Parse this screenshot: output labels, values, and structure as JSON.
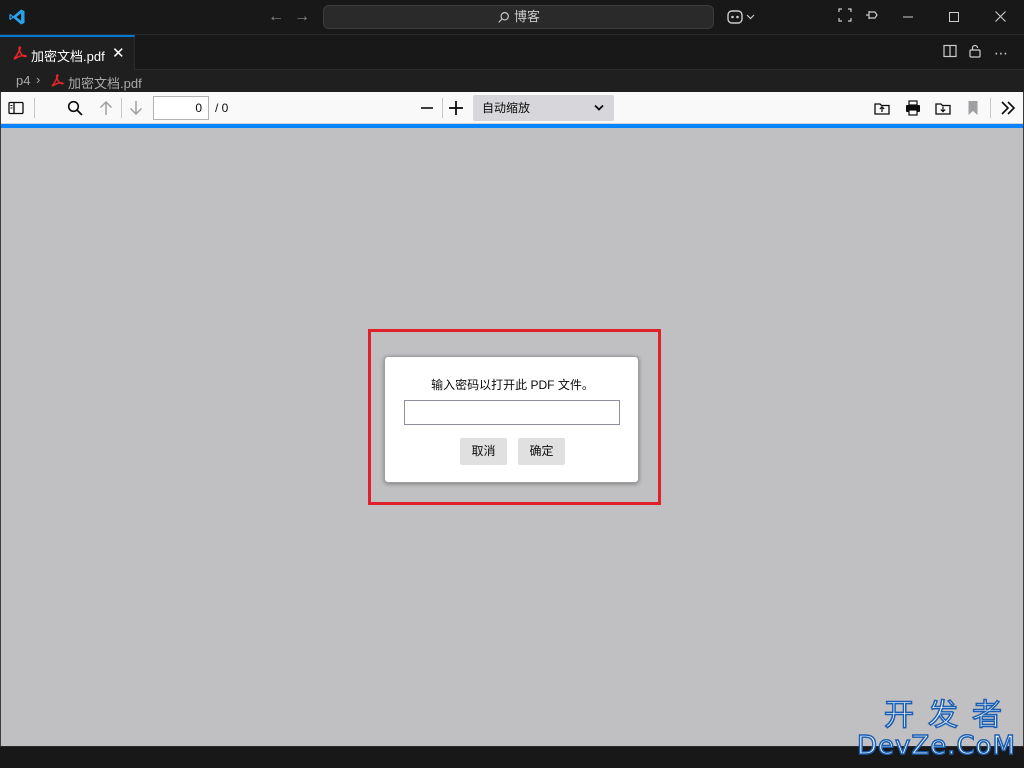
{
  "titlebar": {
    "search_text": "博客",
    "icons": {
      "logo": "vscode-logo-icon",
      "back": "arrow-left-icon",
      "forward": "arrow-right-icon",
      "search": "search-icon",
      "copilot": "copilot-icon",
      "layout": "customize-layout-icon",
      "pin": "pin-icon",
      "minimize": "minimize-icon",
      "maximize": "maximize-icon",
      "close": "close-icon"
    }
  },
  "tabs": [
    {
      "label": "加密文档.pdf",
      "icon": "pdf-icon",
      "active": true
    }
  ],
  "tab_actions": [
    "split-editor-icon",
    "lock-icon",
    "more-icon"
  ],
  "breadcrumb": {
    "folder": "p4",
    "file": "加密文档.pdf"
  },
  "pdf_toolbar": {
    "page_value": "0",
    "page_count": "/ 0",
    "zoom_label": "自动缩放"
  },
  "dialog": {
    "message": "输入密码以打开此 PDF 文件。",
    "password_value": "",
    "cancel_label": "取消",
    "ok_label": "确定"
  },
  "watermark": {
    "line1": "开发者",
    "line2": "DevZe.CoM"
  },
  "colors": {
    "accent": "#0078d4",
    "highlight": "#e0202a",
    "pdf_icon": "#e5252a",
    "viewer_bg": "#c0bfc1"
  }
}
